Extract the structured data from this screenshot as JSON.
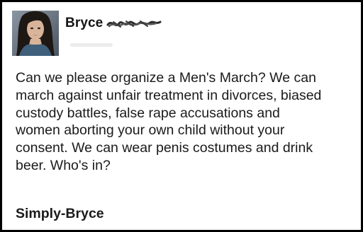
{
  "post": {
    "author_name": "Bryce",
    "body": "Can we please organize a Men's March? We can\nmarch against unfair treatment in divorces, biased\ncustody battles, false rape accusations and\nwomen aborting your own child without your\nconsent. We can wear penis costumes and drink\nbeer. Who's in?",
    "signature": "Simply-Bryce"
  },
  "colors": {
    "border": "#000000",
    "text": "#1a1a1a",
    "background": "#ffffff"
  },
  "icons": {
    "avatar": "profile-photo",
    "redaction": "scribbled-out-surname"
  }
}
